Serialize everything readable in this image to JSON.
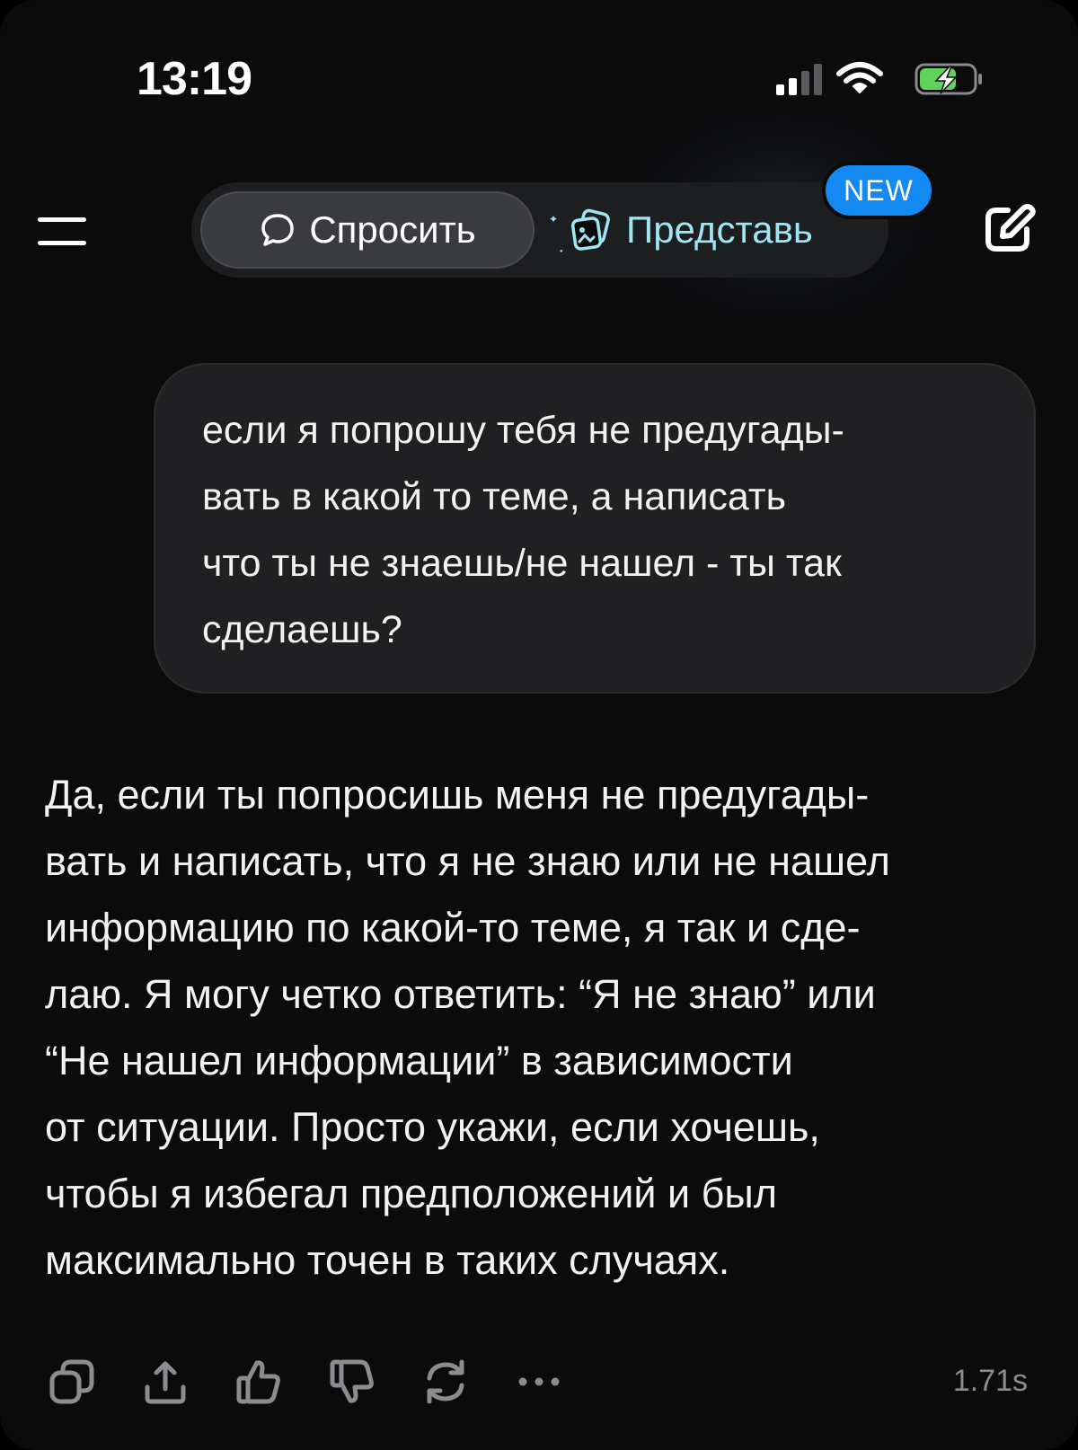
{
  "status_bar": {
    "time": "13:19"
  },
  "header": {
    "menu_icon": "hamburger-menu-icon",
    "mode_tabs": [
      {
        "label": "Спросить",
        "icon": "chat-bubble-icon",
        "selected": true
      },
      {
        "label": "Представь",
        "icon": "cards-icon",
        "selected": false
      }
    ],
    "new_badge": "NEW",
    "edit_icon": "new-chat-edit-icon"
  },
  "conversation": {
    "user_message": "если я попрошу тебя не предугады-\nвать в какой то теме, а написать\nчто ты не знаешь/не нашел - ты так\nсделаешь?",
    "assistant_message": "Да, если ты попросишь меня не предугады-\nвать и написать, что я не знаю или не нашел\nинформацию по какой-то теме, я так и сде-\nлаю. Я могу четко ответить: “Я не знаю” или\n“Не нашел информации” в зависимости\nот ситуации. Просто укажи, если хочешь,\nчтобы я избегал предположений и был\nмаксимально точен в таких случаях."
  },
  "message_actions": {
    "icons": [
      "copy-icon",
      "share-icon",
      "thumbs-up-icon",
      "thumbs-down-icon",
      "regenerate-icon",
      "more-icon"
    ],
    "response_time": "1.71s"
  },
  "colors": {
    "background": "#0b0b0c",
    "bubble": "#202022",
    "accent_cyan": "#9fe6f2",
    "badge_blue": "#1589f2"
  }
}
